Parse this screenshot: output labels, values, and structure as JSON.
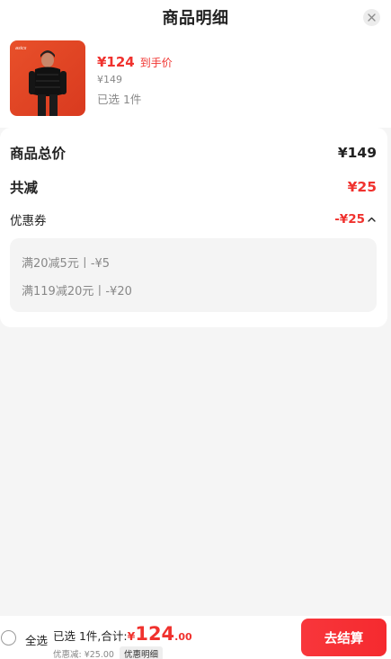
{
  "header": {
    "title": "商品明细",
    "close_icon": "close-icon"
  },
  "product": {
    "image_icon": "product-thumbnail",
    "price": "¥124",
    "price_tag": "到手价",
    "original_price": "¥149",
    "selected_count": "已选 1件"
  },
  "breakdown": {
    "total_label": "商品总价",
    "total_value": "¥149",
    "reduce_label": "共减",
    "reduce_value": "¥25",
    "coupon_label": "优惠券",
    "coupon_value": "-¥25",
    "coupon_toggle_icon": "chevron-up-icon",
    "coupons": [
      "满20减5元丨-¥5",
      "满119减20元丨-¥20"
    ]
  },
  "bottom_bar": {
    "select_all_label": "全选",
    "summary_text": "已选 1件,合计:",
    "currency": "¥",
    "total_integer": "124",
    "total_decimal": ".00",
    "discount_text": "优惠减: ¥25.00",
    "detail_chip": "优惠明细",
    "checkout_label": "去结算"
  },
  "colors": {
    "accent": "#f0322e",
    "background": "#f5f5f5",
    "card": "#ffffff"
  }
}
